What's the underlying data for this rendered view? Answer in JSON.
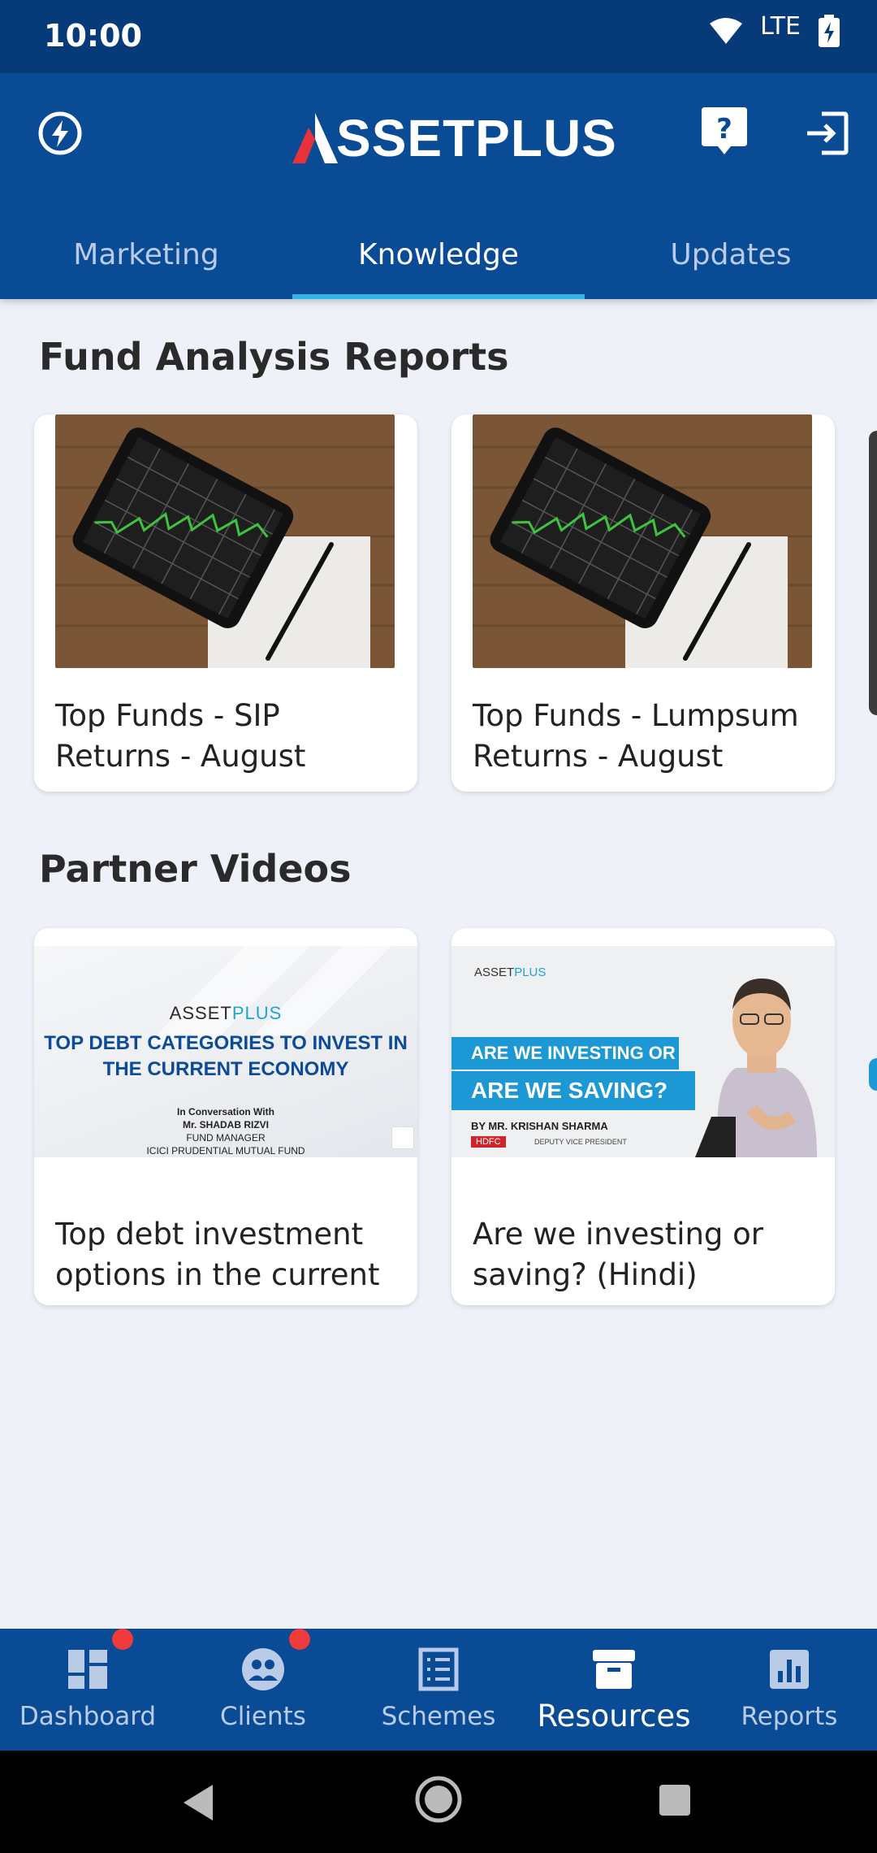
{
  "status_bar": {
    "time": "10:00",
    "network": "LTE",
    "icons": [
      "wifi-icon",
      "battery-charging-icon"
    ]
  },
  "header": {
    "logo_text": "SSETPLUS",
    "icons": [
      "flash-icon",
      "help-icon",
      "logout-icon"
    ]
  },
  "tabs": [
    {
      "label": "Marketing",
      "active": false
    },
    {
      "label": "Knowledge",
      "active": true
    },
    {
      "label": "Updates",
      "active": false
    }
  ],
  "fund_reports": {
    "title": "Fund Analysis Reports",
    "cards": [
      {
        "caption": "Top Funds - SIP Returns - August"
      },
      {
        "caption": "Top Funds - Lumpsum Returns - August"
      }
    ]
  },
  "partner_videos": {
    "title": "Partner Videos",
    "cards": [
      {
        "caption": "Top debt investment options in the current ...",
        "thumb": {
          "brand_a": "ASSET",
          "brand_b": "PLUS",
          "headline_1": "TOP DEBT CATEGORIES TO INVEST IN",
          "headline_2": "THE CURRENT ECONOMY",
          "line_1": "In Conversation With",
          "line_2": "Mr. SHADAB RIZVI",
          "line_3": "FUND MANAGER",
          "line_4": "ICICI PRUDENTIAL MUTUAL FUND"
        }
      },
      {
        "caption": "Are we investing or saving? (Hindi)",
        "thumb": {
          "brand_a": "ASSET",
          "brand_b": "PLUS",
          "banner_1": "ARE WE INVESTING OR",
          "banner_2": "ARE WE SAVING?",
          "by": "BY MR. KRISHAN SHARMA",
          "org": "HDFC",
          "role": "DEPUTY VICE PRESIDENT"
        }
      }
    ]
  },
  "bottom_nav": [
    {
      "label": "Dashboard",
      "icon": "dashboard-icon",
      "badge": true,
      "active": false
    },
    {
      "label": "Clients",
      "icon": "clients-icon",
      "badge": true,
      "active": false
    },
    {
      "label": "Schemes",
      "icon": "schemes-icon",
      "badge": false,
      "active": false
    },
    {
      "label": "Resources",
      "icon": "resources-icon",
      "badge": false,
      "active": true
    },
    {
      "label": "Reports",
      "icon": "reports-icon",
      "badge": false,
      "active": false
    }
  ],
  "colors": {
    "primary": "#0a4b96",
    "status_bar": "#063a78",
    "tab_indicator": "#35b4e6",
    "badge": "#ef3b3b",
    "background": "#eef1f7"
  }
}
